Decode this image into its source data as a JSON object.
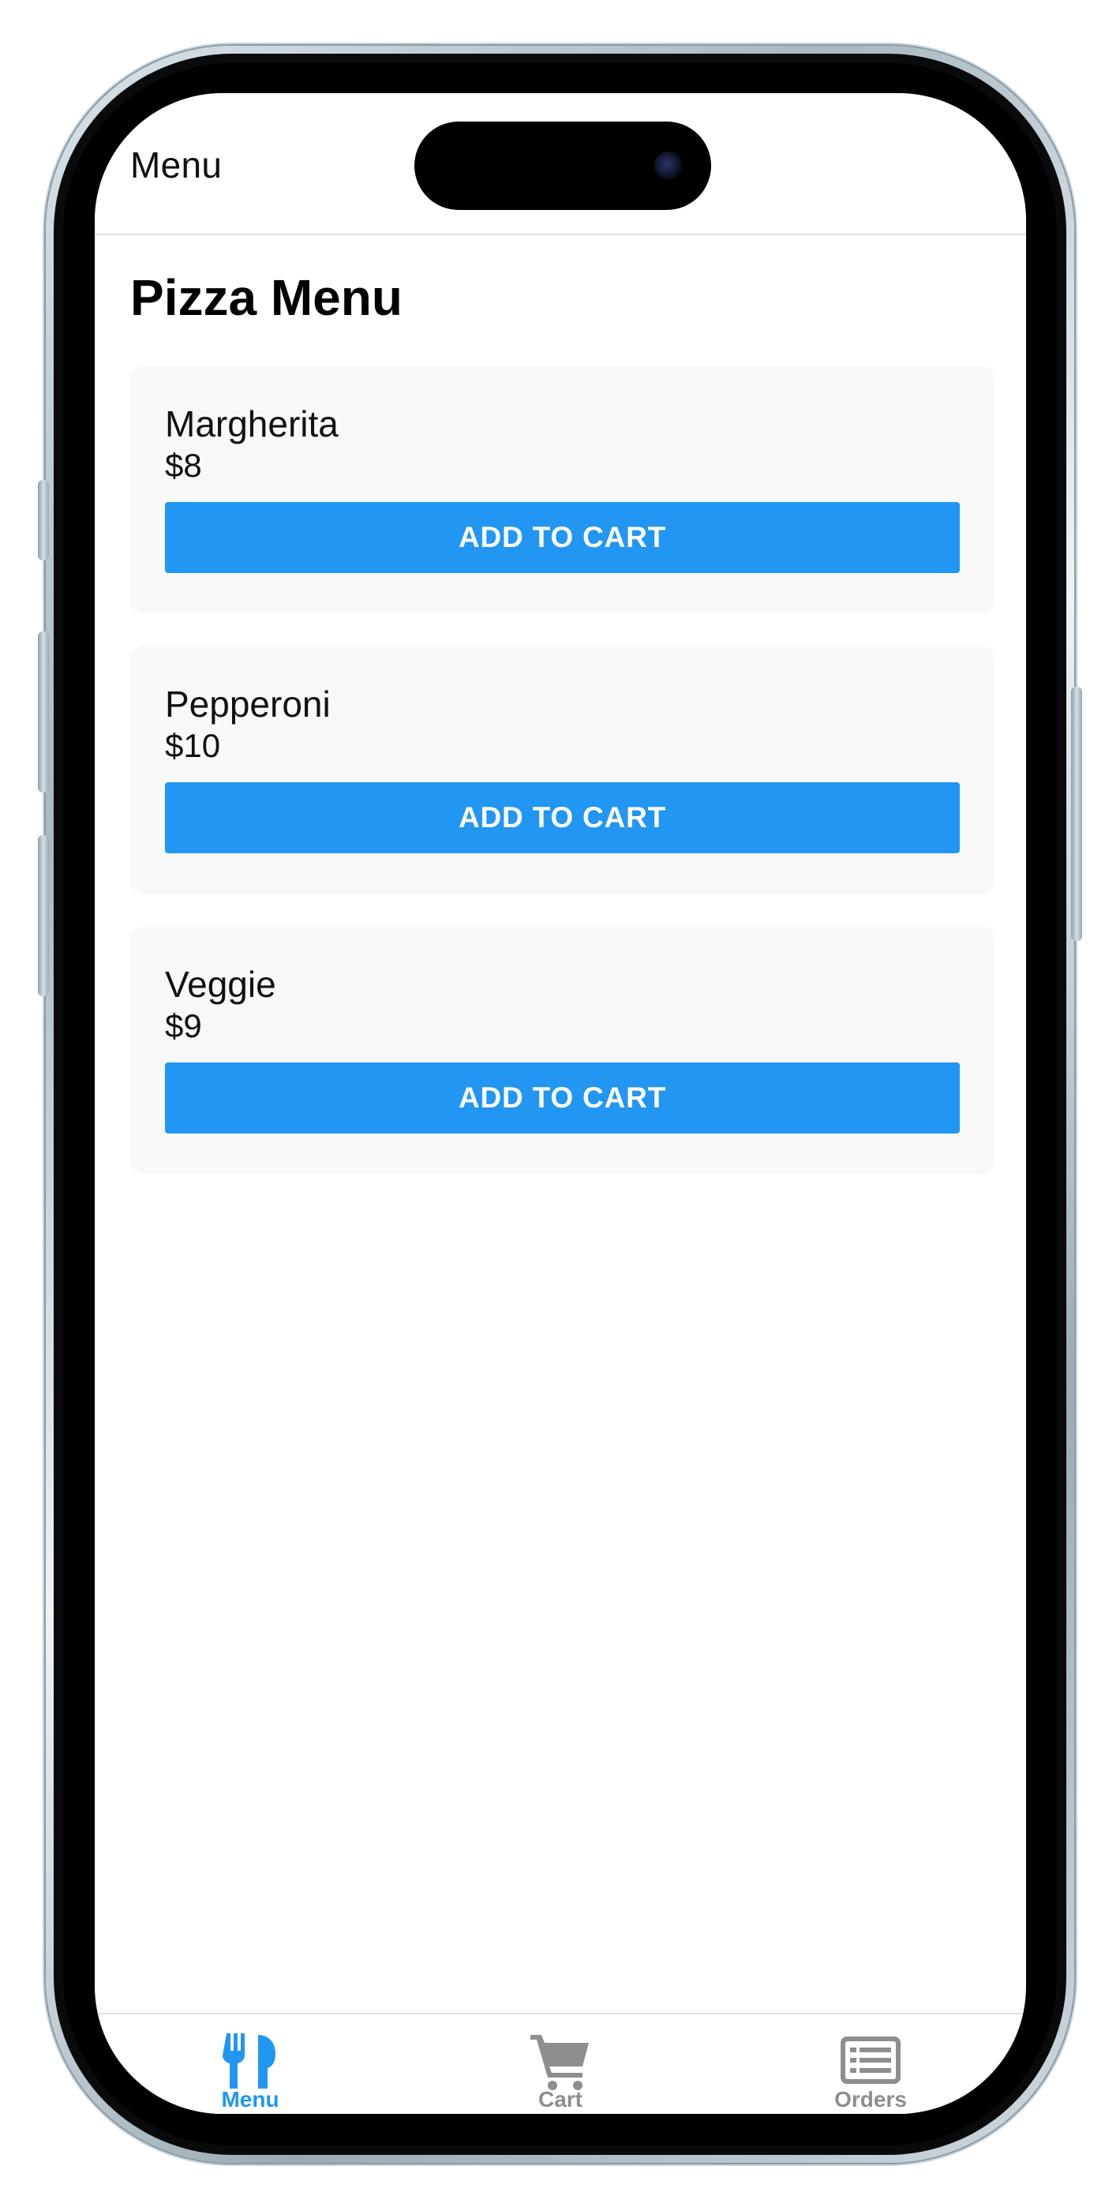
{
  "header": {
    "title": "Menu"
  },
  "page": {
    "title": "Pizza Menu"
  },
  "menu_items": [
    {
      "name": "Margherita",
      "price": "$8",
      "button_label": "ADD TO CART"
    },
    {
      "name": "Pepperoni",
      "price": "$10",
      "button_label": "ADD TO CART"
    },
    {
      "name": "Veggie",
      "price": "$9",
      "button_label": "ADD TO CART"
    }
  ],
  "tabs": [
    {
      "label": "Menu",
      "icon": "fork-knife-icon",
      "active": true
    },
    {
      "label": "Cart",
      "icon": "cart-icon",
      "active": false
    },
    {
      "label": "Orders",
      "icon": "list-icon",
      "active": false
    }
  ],
  "colors": {
    "accent": "#2196f3",
    "tab_active": "#2196f3",
    "tab_inactive": "#8e8e8e",
    "card_background": "#f8f8f8"
  }
}
